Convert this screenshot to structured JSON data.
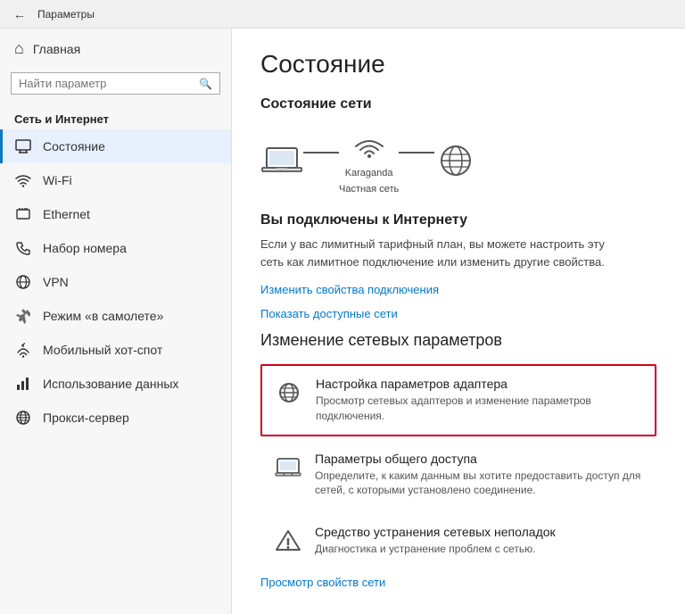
{
  "titlebar": {
    "back_label": "←",
    "title": "Параметры"
  },
  "sidebar": {
    "home_label": "Главная",
    "search_placeholder": "Найти параметр",
    "section_title": "Сеть и Интернет",
    "items": [
      {
        "id": "status",
        "label": "Состояние",
        "icon": "monitor",
        "active": true
      },
      {
        "id": "wifi",
        "label": "Wi-Fi",
        "icon": "wifi"
      },
      {
        "id": "ethernet",
        "label": "Ethernet",
        "icon": "ethernet"
      },
      {
        "id": "dialup",
        "label": "Набор номера",
        "icon": "phone"
      },
      {
        "id": "vpn",
        "label": "VPN",
        "icon": "vpn"
      },
      {
        "id": "airplane",
        "label": "Режим «в самолете»",
        "icon": "airplane"
      },
      {
        "id": "hotspot",
        "label": "Мобильный хот-спот",
        "icon": "hotspot"
      },
      {
        "id": "datausage",
        "label": "Использование данных",
        "icon": "data"
      },
      {
        "id": "proxy",
        "label": "Прокси-сервер",
        "icon": "proxy"
      }
    ]
  },
  "main": {
    "page_title": "Состояние",
    "network_section_title": "Состояние сети",
    "network_node_label": "Karaganda",
    "network_node_sublabel": "Частная сеть",
    "connected_title": "Вы подключены к Интернету",
    "connected_desc": "Если у вас лимитный тарифный план, вы можете настроить эту сеть как лимитное подключение или изменить другие свойства.",
    "link_change_props": "Изменить свойства подключения",
    "link_show_networks": "Показать доступные сети",
    "change_section_title": "Изменение сетевых параметров",
    "cards": [
      {
        "id": "adapter",
        "title": "Настройка параметров адаптера",
        "desc": "Просмотр сетевых адаптеров и изменение параметров подключения.",
        "highlighted": true
      },
      {
        "id": "sharing",
        "title": "Параметры общего доступа",
        "desc": "Определите, к каким данным вы хотите предоставить доступ для сетей, с которыми установлено соединение.",
        "highlighted": false
      },
      {
        "id": "troubleshoot",
        "title": "Средство устранения сетевых неполадок",
        "desc": "Диагностика и устранение проблем с сетью.",
        "highlighted": false
      }
    ],
    "link_view_properties": "Просмотр свойств сети"
  }
}
